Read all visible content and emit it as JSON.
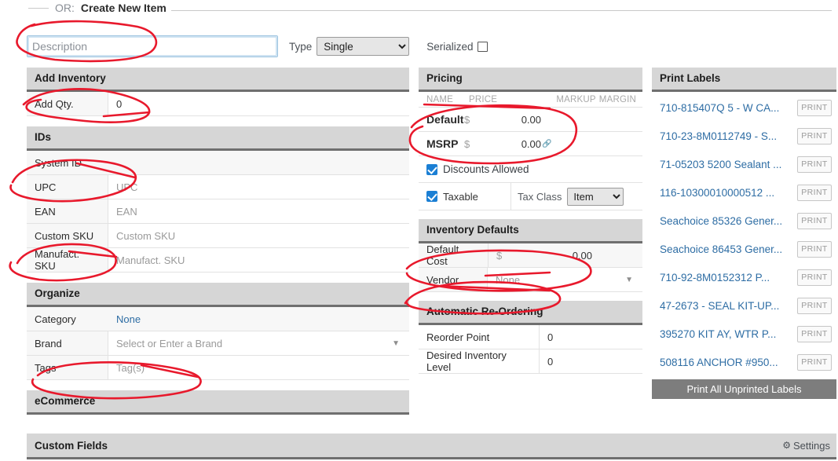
{
  "header": {
    "or_text": "OR:",
    "title": "Create New Item"
  },
  "form_top": {
    "description_placeholder": "Description",
    "description_value": "",
    "type_label": "Type",
    "type_value": "Single",
    "type_options": [
      "Single"
    ],
    "serialized_label": "Serialized",
    "serialized_checked": false
  },
  "add_inventory": {
    "section_title": "Add Inventory",
    "rows": [
      {
        "label": "Add Qty.",
        "value": "0"
      }
    ]
  },
  "ids": {
    "section_title": "IDs",
    "rows": [
      {
        "label": "System ID",
        "value": "",
        "placeholder": ""
      },
      {
        "label": "UPC",
        "value": "",
        "placeholder": "UPC"
      },
      {
        "label": "EAN",
        "value": "",
        "placeholder": "EAN"
      },
      {
        "label": "Custom SKU",
        "value": "",
        "placeholder": "Custom SKU"
      },
      {
        "label": "Manufact. SKU",
        "value": "",
        "placeholder": "Manufact. SKU"
      }
    ]
  },
  "organize": {
    "section_title": "Organize",
    "category_label": "Category",
    "category_value": "None",
    "brand_label": "Brand",
    "brand_placeholder": "Select or Enter a Brand",
    "tags_label": "Tags",
    "tags_placeholder": "Tag(s)"
  },
  "ecommerce": {
    "section_title": "eCommerce"
  },
  "pricing": {
    "section_title": "Pricing",
    "columns": [
      "NAME",
      "PRICE",
      "MARKUP",
      "MARGIN"
    ],
    "rows": [
      {
        "name": "Default",
        "currency": "$",
        "price": "0.00",
        "markup": "",
        "margin": "",
        "linked": false
      },
      {
        "name": "MSRP",
        "currency": "$",
        "price": "0.00",
        "markup": "",
        "margin": "",
        "linked": true
      }
    ],
    "discounts_allowed_label": "Discounts Allowed",
    "discounts_allowed_checked": true,
    "taxable_label": "Taxable",
    "taxable_checked": true,
    "tax_class_label": "Tax Class",
    "tax_class_value": "Item",
    "tax_class_options": [
      "Item"
    ]
  },
  "inventory_defaults": {
    "section_title": "Inventory Defaults",
    "default_cost_label": "Default Cost",
    "default_cost_currency": "$",
    "default_cost_value": "0.00",
    "vendor_label": "Vendor",
    "vendor_value": "None"
  },
  "auto_reordering": {
    "section_title": "Automatic Re-Ordering",
    "rows": [
      {
        "label": "Reorder Point",
        "value": "0"
      },
      {
        "label": "Desired Inventory Level",
        "value": "0"
      }
    ]
  },
  "print_labels": {
    "section_title": "Print Labels",
    "print_button_label": "PRINT",
    "print_all_label": "Print All Unprinted Labels",
    "items": [
      {
        "name": "710-815407Q 5 - W CA..."
      },
      {
        "name": "710-23-8M0112749 - S..."
      },
      {
        "name": "71-05203 5200 Sealant ..."
      },
      {
        "name": "116-10300010000512 ..."
      },
      {
        "name": "Seachoice 85326 Gener..."
      },
      {
        "name": "Seachoice 86453 Gener..."
      },
      {
        "name": "710-92-8M0152312 P..."
      },
      {
        "name": "47-2673 - SEAL KIT-UP..."
      },
      {
        "name": "395270 KIT AY, WTR P..."
      },
      {
        "name": "508116 ANCHOR #950..."
      }
    ]
  },
  "custom_fields": {
    "section_title": "Custom Fields",
    "settings_label": "Settings",
    "settings_icon": "gear-icon"
  },
  "colors": {
    "section_header_bg": "#d6d6d6",
    "section_header_rule": "#6f6f6f",
    "link_blue": "#2e6da4",
    "checkbox_blue": "#1b7fd4",
    "annotation_red": "#e8192c",
    "button_gray": "#7d7d7d",
    "focus_border": "#9ec5e0"
  },
  "annotations": {
    "color": "#e8192c",
    "description": "hand-drawn red circles highlighting fields",
    "marks": [
      "circle-around-description-field",
      "circle-around-add-qty",
      "circle-around-upc-system-id",
      "circle-around-manufact-sku",
      "circle-around-tags",
      "circle-around-default-msrp-price",
      "circle-around-default-cost",
      "circle-around-vendor"
    ]
  }
}
